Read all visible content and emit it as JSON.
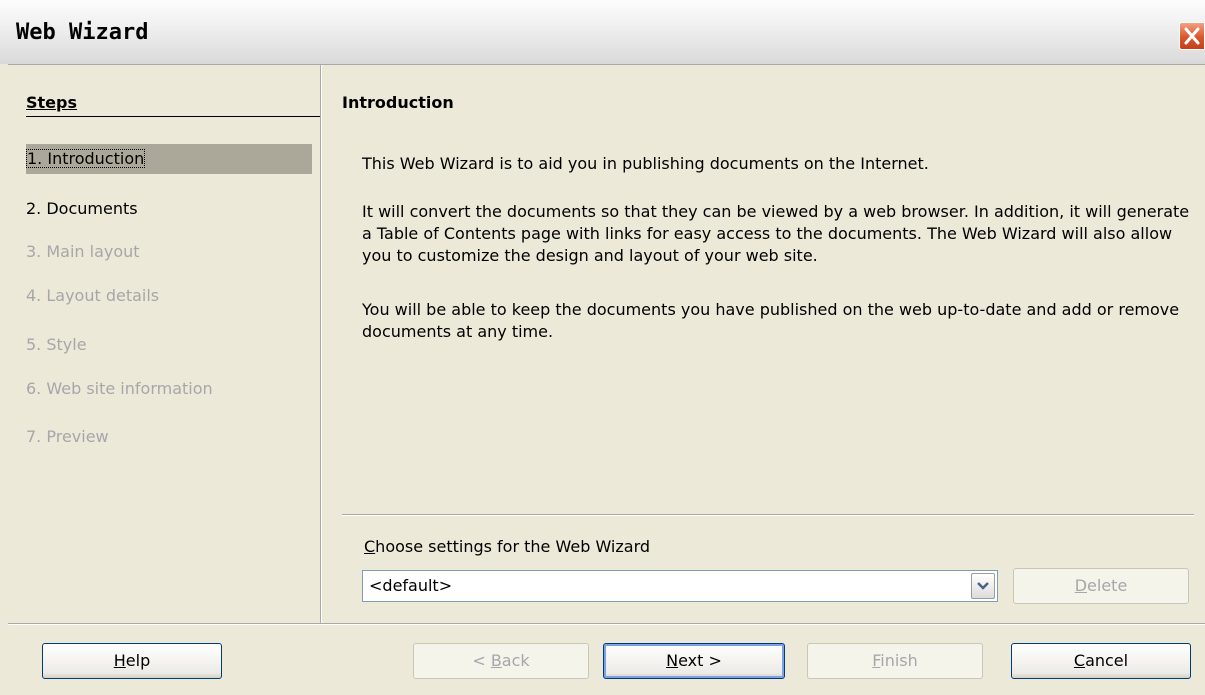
{
  "window": {
    "title": "Web Wizard"
  },
  "steps": {
    "heading": "Steps",
    "items": [
      {
        "label": "1. Introduction",
        "state": "selected"
      },
      {
        "label": "2. Documents",
        "state": "enabled"
      },
      {
        "label": "3. Main layout",
        "state": "disabled"
      },
      {
        "label": "4. Layout details",
        "state": "disabled"
      },
      {
        "label": "5. Style",
        "state": "disabled"
      },
      {
        "label": "6. Web site information",
        "state": "disabled"
      },
      {
        "label": "7. Preview",
        "state": "disabled"
      }
    ]
  },
  "content": {
    "title": "Introduction",
    "paragraphs": [
      "This Web Wizard is to aid you in publishing documents on the Internet.",
      "It will convert the documents so that they can be viewed by a web browser. In addition, it will generate a Table of Contents page with links for easy access to the documents. The Web Wizard will also allow you to customize the design and layout of your web site.",
      "You will be able to keep the documents you have published on the web up-to-date and add or remove documents at any time."
    ],
    "settings_label_mnemonic": "C",
    "settings_label_rest": "hoose settings for the Web Wizard",
    "settings_value": "<default>",
    "delete_mnemonic": "D",
    "delete_rest": "elete"
  },
  "footer": {
    "help_mnemonic": "H",
    "help_rest": "elp",
    "back_prefix": "< ",
    "back_mnemonic": "B",
    "back_rest": "ack",
    "next_mnemonic": "N",
    "next_rest": "ext >",
    "finish_mnemonic": "F",
    "finish_rest": "inish",
    "cancel_mnemonic": "C",
    "cancel_rest": "ancel"
  },
  "colors": {
    "dialog_bg": "#ece9d8",
    "selected_step_bg": "#aca899",
    "disabled_text": "#a7a6aa",
    "close_button": "#d9572d"
  },
  "icons": {
    "close": "close-icon",
    "dropdown": "chevron-down-icon"
  }
}
